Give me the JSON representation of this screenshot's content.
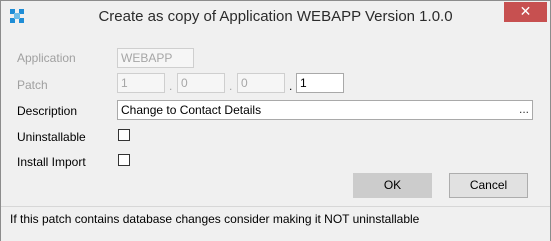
{
  "window": {
    "title": "Create as copy of Application WEBAPP Version 1.0.0",
    "close_glyph": "✕"
  },
  "form": {
    "application": {
      "label": "Application",
      "value": "WEBAPP"
    },
    "patch": {
      "label": "Patch",
      "parts": [
        "1",
        "0",
        "0",
        "1"
      ],
      "separator": "."
    },
    "description": {
      "label": "Description",
      "value": "Change to Contact Details",
      "ellipsis": "..."
    },
    "uninstallable": {
      "label": "Uninstallable",
      "checked": false
    },
    "install_import": {
      "label": "Install Import",
      "checked": false
    }
  },
  "buttons": {
    "ok": "OK",
    "cancel": "Cancel"
  },
  "status": {
    "text": "If this patch contains database changes consider making it NOT uninstallable"
  },
  "colors": {
    "accent": "#1f8dd6",
    "close": "#c75050"
  },
  "icons": {
    "app": "app-window-icon",
    "close": "close-icon"
  }
}
